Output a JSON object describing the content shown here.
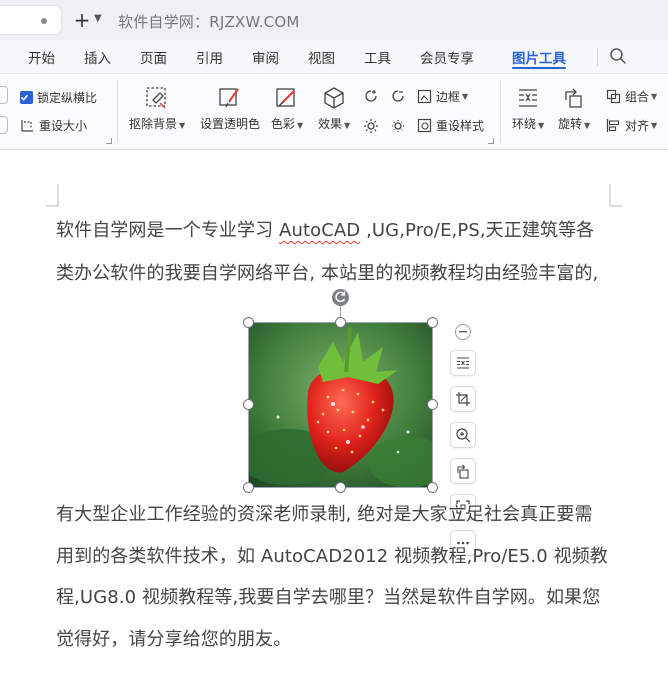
{
  "titlebar": {
    "doc_title": "软件自学网：RJZXW.COM"
  },
  "menu": {
    "items": [
      "开始",
      "插入",
      "页面",
      "引用",
      "审阅",
      "视图",
      "工具",
      "会员专享",
      "图片工具"
    ],
    "active": "图片工具"
  },
  "ribbon": {
    "lock_ratio": "锁定纵横比",
    "resize": "重设大小",
    "remove_bg": "抠除背景",
    "set_transparent": "设置透明色",
    "color": "色彩",
    "effects": "效果",
    "border": "边框",
    "reset_style": "重设样式",
    "wrap": "环绕",
    "rotate": "旋转",
    "group": "组合",
    "align": "对齐"
  },
  "document": {
    "line1_a": "软件自学网是一个专业学习 ",
    "line1_b": "AutoCAD",
    "line1_c": " ,UG,Pro/E,PS,天正建筑等各",
    "line2": "类办公软件的我要自学网络平台, 本站里的视频教程均由经验丰富的,",
    "line3": "有大型企业工作经验的资深老师录制, 绝对是大家立足社会真正要需",
    "line4": "用到的各类软件技术，如 AutoCAD2012 视频教程,Pro/E5.0 视频教",
    "line5": "程,UG8.0 视频教程等,我要自学去哪里？当然是软件自学网。如果您",
    "line6": "觉得好，请分享给您的朋友。"
  },
  "colors": {
    "accent": "#2a63d8",
    "spell_error": "#e03a3a"
  }
}
